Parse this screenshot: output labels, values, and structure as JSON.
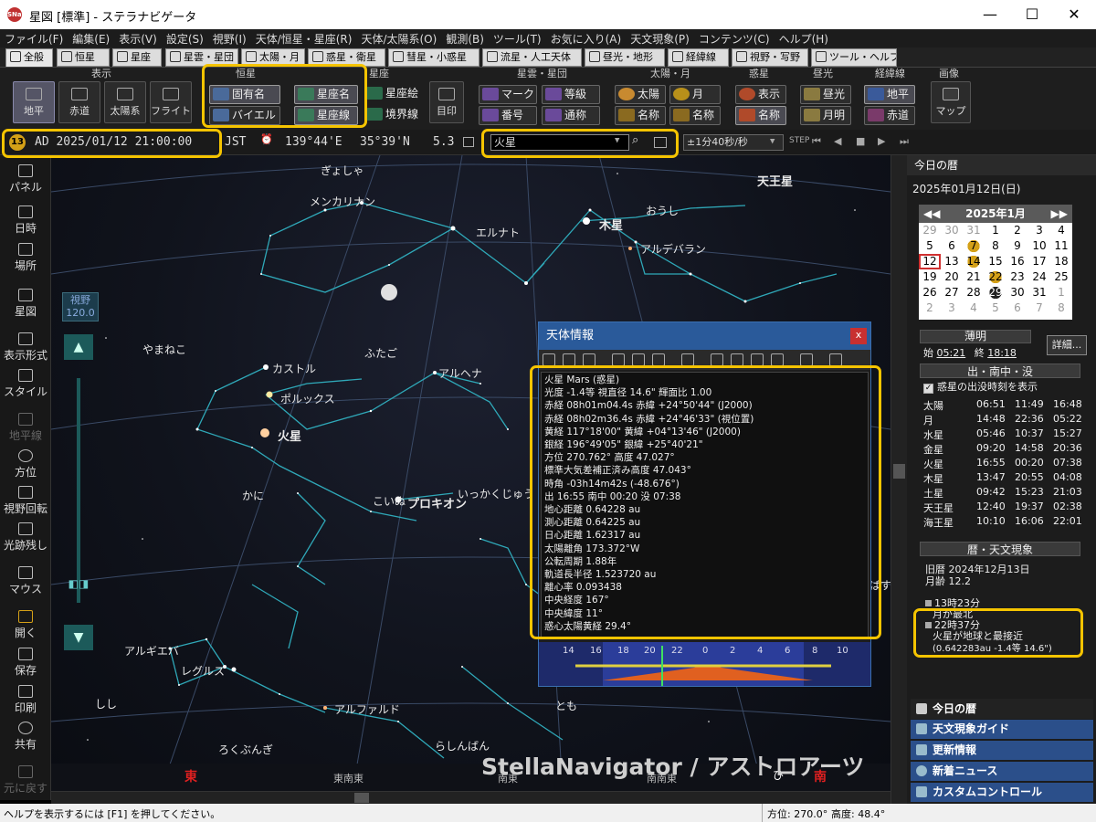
{
  "window": {
    "title": "星図 [標準] - ステラナビゲータ",
    "app_icon": "SNav",
    "controls": {
      "minimize": "—",
      "maximize": "☐",
      "close": "✕"
    }
  },
  "menu": [
    "ファイル(F)",
    "編集(E)",
    "表示(V)",
    "設定(S)",
    "視野(I)",
    "天体/恒星・星座(R)",
    "天体/太陽系(O)",
    "観測(B)",
    "ツール(T)",
    "お気に入り(A)",
    "天文現象(P)",
    "コンテンツ(C)",
    "ヘルプ(H)"
  ],
  "tabs": [
    "全般",
    "恒星",
    "星雲・星団",
    "太陽・月",
    "惑星・衛星",
    "彗星・小惑星",
    "流星・人工天体",
    "昼光・地形",
    "経緯線",
    "視野・写野",
    "ツール・ヘルプ"
  ],
  "toolbar": {
    "groups": {
      "display": "表示",
      "stars": "恒星",
      "constellation": "星座",
      "nebula": "星雲・星団",
      "sunmoon": "太陽・月",
      "planet": "惑星",
      "daylight": "昼光",
      "grid": "経緯線",
      "image": "画像"
    },
    "display_buttons": [
      "地平",
      "赤道",
      "太陽系",
      "フライト"
    ],
    "star_buttons": [
      "固有名",
      "バイエル"
    ],
    "constellation_buttons": [
      "星座名",
      "星座線",
      "星座絵",
      "境界線",
      "目印"
    ],
    "nebula_buttons": [
      "マーク",
      "等級",
      "番号",
      "通称"
    ],
    "sunmoon_buttons": [
      "太陽",
      "月",
      "名称",
      "名称"
    ],
    "planet_buttons": [
      "表示",
      "名称"
    ],
    "daylight_buttons": [
      "昼光",
      "月明"
    ],
    "grid_buttons": [
      "地平",
      "赤道"
    ],
    "image_buttons": [
      "マップ"
    ]
  },
  "statusbar": {
    "badge": "13",
    "datetime": "AD 2025/01/12 21:00:00",
    "timezone": "JST",
    "longitude": "139°44'E",
    "latitude": "35°39'N",
    "magnitude": "5.3",
    "search_value": "火星",
    "step": "±1分40秒/秒"
  },
  "leftbar": [
    "パネル",
    "日時",
    "場所",
    "星図",
    "表示形式",
    "スタイル",
    "地平線",
    "方位",
    "視野回転",
    "光跡残し",
    "マウス",
    "開く",
    "保存",
    "印刷",
    "共有",
    "元に戻す"
  ],
  "fov": {
    "label": "視野",
    "value": "120.0"
  },
  "sky": {
    "labels": {
      "uranus": "天王星",
      "gyosha": "ぎょしゃ",
      "menkalinan": "メンカリナン",
      "elnath": "エルナト",
      "jupiter": "木星",
      "oushi": "おうし",
      "aldebaran": "アルデバラン",
      "yamaneko": "やまねこ",
      "futago": "ふたご",
      "castor": "カストル",
      "alhena": "アルヘナ",
      "pollux": "ポルックス",
      "mars": "火星",
      "kani": "かに",
      "koinu": "こいぬ",
      "procyon": "プロキオン",
      "ikkakujuu": "いっかくじゅう",
      "algieba": "アルギエバ",
      "regulus": "レグルス",
      "shishi": "しし",
      "alphard": "アルファルド",
      "tomo": "とも",
      "rokubungi": "ろくぶんぎ",
      "rashinban": "らしんばん",
      "hato": "ぱす"
    },
    "compass": {
      "east": "東",
      "ene": "東南東",
      "se": "南東",
      "sse": "南南東",
      "south": "南",
      "s": "ひ"
    },
    "watermark": "StellaNavigator / アストロアーツ"
  },
  "info_window": {
    "title": "天体情報",
    "lines": [
      "火星 Mars (惑星)",
      "光度 -1.4等  視直径 14.6\"  輝面比 1.00",
      "赤経 08h01m04.4s  赤緯 +24°50'44\" (J2000)",
      "赤経 08h02m36.4s  赤緯 +24°46'33\" (視位置)",
      "黄経 117°18'00\"   黄緯 +04°13'46\" (J2000)",
      "銀経 196°49'05\"   銀緯 +25°40'21\"",
      "方位 270.762°     高度  47.027°",
      "標準大気差補正済み高度  47.043°",
      "時角 -03h14m42s (-48.676°)",
      "出 16:55  南中 00:20  没 07:38",
      "地心距離  0.64228 au",
      "測心距離  0.64225 au",
      "日心距離  1.62317 au",
      "太陽離角 173.372°W",
      "公転周期 1.88年",
      "軌道長半径 1.523720 au",
      "離心率 0.093438",
      "中央経度 167°",
      "中央緯度  11°",
      "惑心太陽黄経  29.4°"
    ],
    "chart_hours": [
      "14",
      "16",
      "18",
      "20",
      "22",
      "0",
      "2",
      "4",
      "6",
      "8",
      "10"
    ]
  },
  "right_panel": {
    "title": "今日の暦",
    "date": "2025年01月12日(日)",
    "calendar": {
      "month": "2025年1月",
      "rows": [
        [
          "29",
          "30",
          "31",
          "1",
          "2",
          "3",
          "4"
        ],
        [
          "5",
          "6",
          "7",
          "8",
          "9",
          "10",
          "11"
        ],
        [
          "12",
          "13",
          "14",
          "15",
          "16",
          "17",
          "18"
        ],
        [
          "19",
          "20",
          "21",
          "22",
          "23",
          "24",
          "25"
        ],
        [
          "26",
          "27",
          "28",
          "29",
          "30",
          "31",
          "1"
        ],
        [
          "2",
          "3",
          "4",
          "5",
          "6",
          "7",
          "8"
        ]
      ]
    },
    "twilight": {
      "title": "薄明",
      "start_label": "始",
      "start": "05:21",
      "end_label": "終",
      "end": "18:18",
      "detail": "詳細..."
    },
    "riset": {
      "title": "出・南中・没",
      "checkbox": "惑星の出没時刻を表示",
      "rows": [
        [
          "太陽",
          "06:51",
          "11:49",
          "16:48"
        ],
        [
          "月",
          "14:48",
          "22:36",
          "05:22"
        ],
        [
          "水星",
          "05:46",
          "10:37",
          "15:27"
        ],
        [
          "金星",
          "09:20",
          "14:58",
          "20:36"
        ],
        [
          "火星",
          "16:55",
          "00:20",
          "07:38"
        ],
        [
          "木星",
          "13:47",
          "20:55",
          "04:08"
        ],
        [
          "土星",
          "09:42",
          "15:23",
          "21:03"
        ],
        [
          "天王星",
          "12:40",
          "19:37",
          "02:38"
        ],
        [
          "海王星",
          "10:10",
          "16:06",
          "22:01"
        ]
      ]
    },
    "phenomena": {
      "title": "暦・天文現象",
      "kyureki": "旧暦 2024年12月13日",
      "moon_age": "月齢 12.2",
      "event1": "13時23分",
      "event1_text": "月が最北",
      "event2": "22時37分",
      "event2_text": "火星が地球と最接近",
      "event2_detail": "(0.642283au -1.4等 14.6\")"
    },
    "nav": [
      "今日の暦",
      "天文現象ガイド",
      "更新情報",
      "新着ニュース",
      "カスタムコントロール"
    ]
  },
  "bottom": {
    "help": "ヘルプを表示するには [F1] を押してください。",
    "azimuth": "方位: 270.0°",
    "altitude": "高度:  48.4°"
  }
}
